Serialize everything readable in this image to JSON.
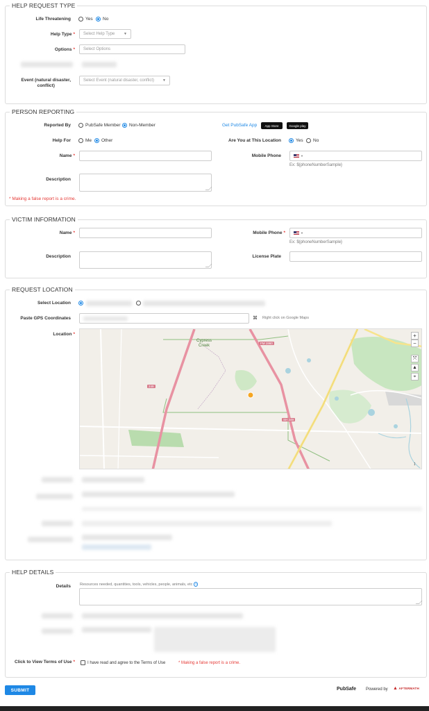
{
  "help_request_type": {
    "legend": "HELP REQUEST TYPE",
    "life_threatening_label": "Life Threatening",
    "yes_label": "Yes",
    "no_label": "No",
    "help_type_label": "Help Type",
    "help_type_placeholder": "Select Help Type",
    "options_label": "Options",
    "options_placeholder": "Select Options",
    "event_label_1": "Event (natural disaster,",
    "event_label_2": "conflict)",
    "event_placeholder": "Select Event (natural disaster, conflict)"
  },
  "person_reporting": {
    "legend": "PERSON REPORTING",
    "reported_by_label": "Reported By",
    "pubsafe_member_label": "PubSafe Member",
    "non_member_label": "Non-Member",
    "get_app_link": "Get PubSafe App",
    "app_store_badge": "App Store",
    "google_play_badge": "Google play",
    "help_for_label": "Help For",
    "me_label": "Me",
    "other_label": "Other",
    "at_location_label": "Are You at This Location",
    "yes_label": "Yes",
    "no_label": "No",
    "name_label": "Name",
    "mobile_phone_label": "Mobile Phone",
    "phone_hint": "Ex: ${phoneNumberSample}",
    "description_label": "Description",
    "false_report_warning": "* Making a false report is a crime."
  },
  "victim_information": {
    "legend": "VICTIM INFORMATION",
    "name_label": "Name",
    "mobile_phone_label": "Mobile Phone",
    "phone_hint": "Ex: ${phoneNumberSample}",
    "description_label": "Description",
    "license_plate_label": "License Plate"
  },
  "request_location": {
    "legend": "REQUEST LOCATION",
    "select_location_label": "Select Location",
    "paste_gps_label": "Paste GPS Coordinates",
    "gps_hint": "Right click on Google Maps",
    "location_label": "Location",
    "map_labels": {
      "cypress_creek_1": "Cypress",
      "cypress_creek_2": "Creek",
      "road_1960": "FM 1960",
      "road_249": "249",
      "road_sh": "SH 249"
    },
    "zoom_in": "+",
    "zoom_out": "−"
  },
  "help_details": {
    "legend": "HELP DETAILS",
    "details_label": "Details",
    "details_hint": "Resources needed, quantities, tools, vehicles, people, animals, etc",
    "terms_label": "Click to View Terms of Use",
    "agree_label": "I have read and agree to the Terms of Use",
    "false_report_warning": "* Making a false report is a crime."
  },
  "footer": {
    "submit_label": "SUBMIT",
    "pubsafe_logo": "PubSafe",
    "powered_by": "Powered by",
    "aftermath_logo": "AFTERMATH"
  },
  "colors": {
    "accent": "#1e88e5",
    "required": "#e53935"
  }
}
